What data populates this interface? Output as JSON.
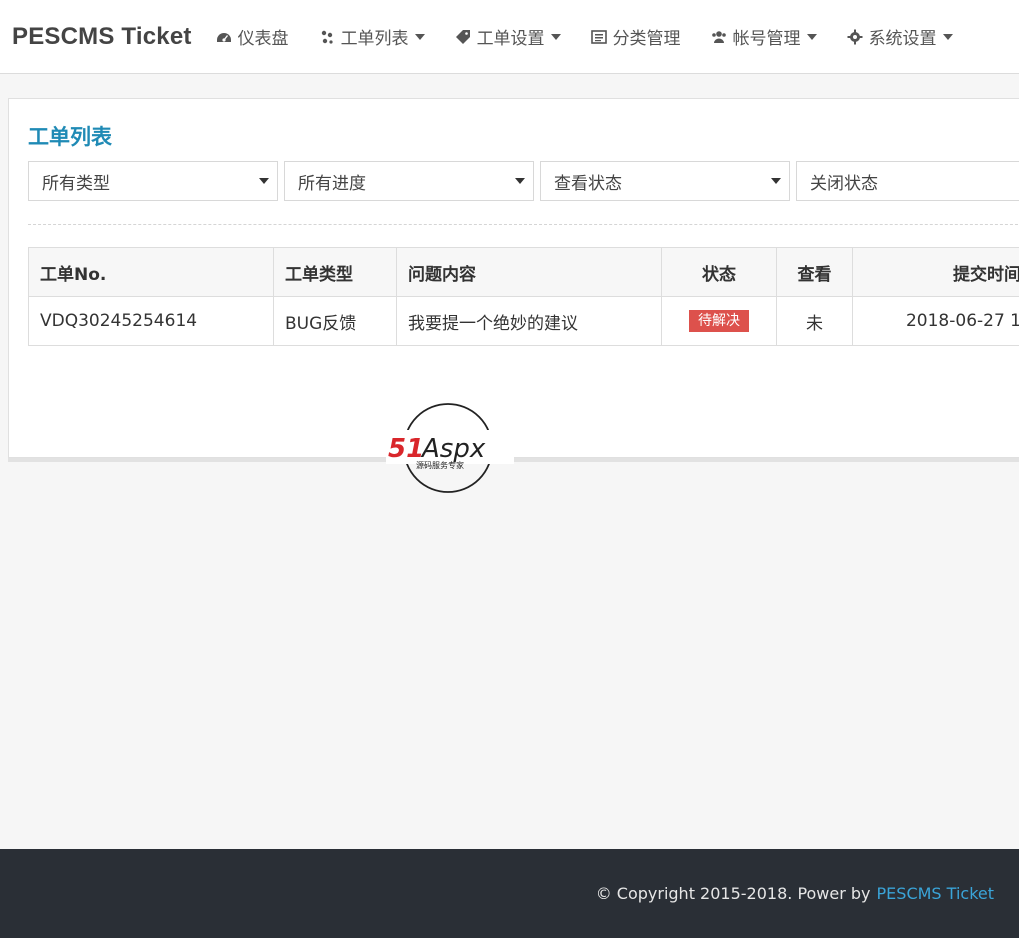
{
  "navbar": {
    "brand": "PESCMS Ticket",
    "items": [
      {
        "label": "仪表盘",
        "icon": "dashboard-icon",
        "dropdown": false
      },
      {
        "label": "工单列表",
        "icon": "ticket-list-icon",
        "dropdown": true
      },
      {
        "label": "工单设置",
        "icon": "tag-icon",
        "dropdown": true
      },
      {
        "label": "分类管理",
        "icon": "list-icon",
        "dropdown": false
      },
      {
        "label": "帐号管理",
        "icon": "users-icon",
        "dropdown": true
      },
      {
        "label": "系统设置",
        "icon": "gear-icon",
        "dropdown": true
      }
    ]
  },
  "page": {
    "title": "工单列表"
  },
  "filters": [
    {
      "value": "所有类型"
    },
    {
      "value": "所有进度"
    },
    {
      "value": "查看状态"
    },
    {
      "value": "关闭状态"
    }
  ],
  "table": {
    "headers": [
      "工单No.",
      "工单类型",
      "问题内容",
      "状态",
      "查看",
      "提交时间"
    ],
    "rows": [
      {
        "no": "VDQ30245254614",
        "type": "BUG反馈",
        "content": "我要提一个绝妙的建议",
        "status": "待解决",
        "viewed": "未",
        "time": "2018-06-27 1"
      }
    ]
  },
  "watermark": {
    "logo_text": "51Aspx",
    "sub_text": "源码服务专家"
  },
  "footer": {
    "copyright": "© Copyright 2015-2018. Power by",
    "link": "PESCMS Ticket"
  },
  "colors": {
    "accent": "#1f8ab5",
    "status_badge": "#dd514c",
    "footer_bg": "#2a2f36",
    "footer_link": "#3aa4d8"
  }
}
